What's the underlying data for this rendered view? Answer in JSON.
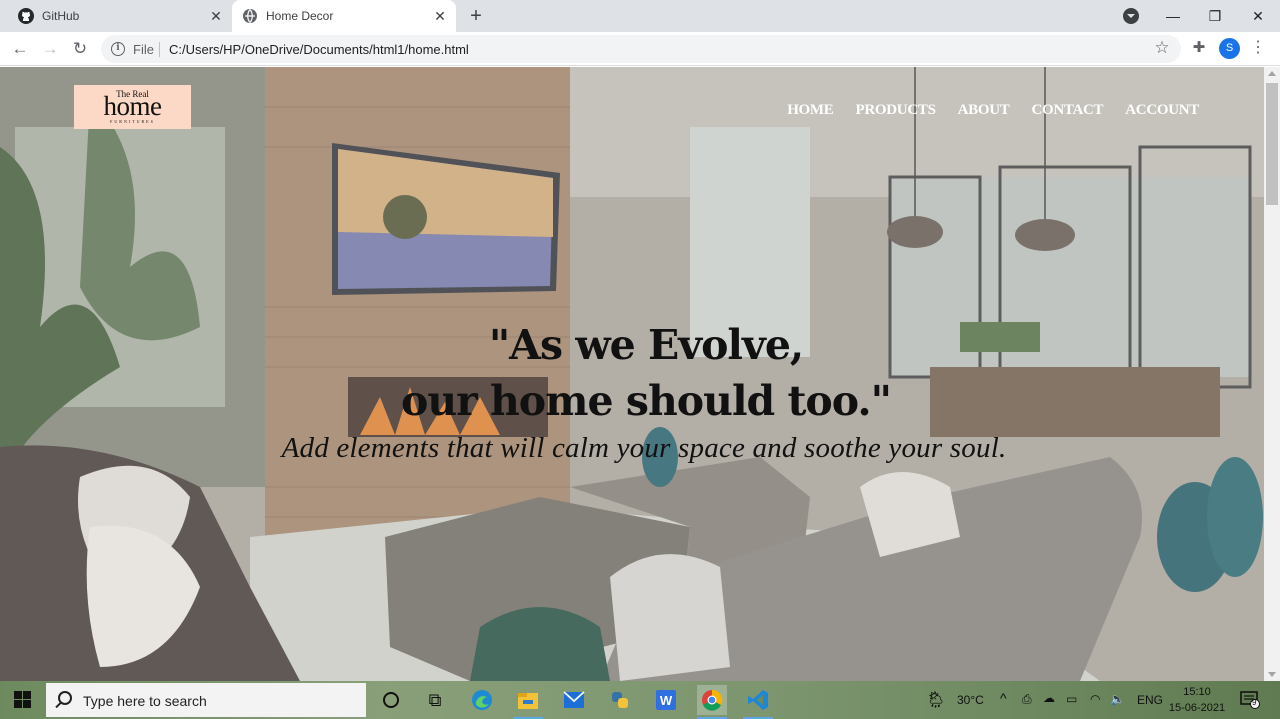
{
  "browser": {
    "tabs": [
      {
        "title": "GitHub",
        "active": false
      },
      {
        "title": "Home Decor",
        "active": true
      }
    ],
    "file_label": "File",
    "url": "C:/Users/HP/OneDrive/Documents/html1/home.html",
    "profile_initial": "S",
    "window_controls": [
      "minimize",
      "maximize",
      "close"
    ]
  },
  "page": {
    "logo": {
      "line1": "The Real",
      "line2": "home",
      "line3": "FURNITURES"
    },
    "nav": [
      "HOME",
      "PRODUCTS",
      "ABOUT",
      "CONTACT",
      "ACCOUNT"
    ],
    "headline_line1": "\"As we Evolve,",
    "headline_line2": "our home should too.\"",
    "subtitle": "Add elements that will calm your space and soothe your soul."
  },
  "taskbar": {
    "search_placeholder": "Type here to search",
    "pinned_apps": [
      "cortana",
      "task-view",
      "edge",
      "file-explorer",
      "mail",
      "python",
      "wps-writer",
      "chrome",
      "vs-code"
    ],
    "weather": "30°C",
    "language": "ENG",
    "time": "15:10",
    "date": "15-06-2021",
    "notification_count": "9"
  },
  "colors": {
    "tab_strip": "#dee1e6",
    "logo_bg": "#fcd9c7",
    "profile": "#1a73e8"
  }
}
